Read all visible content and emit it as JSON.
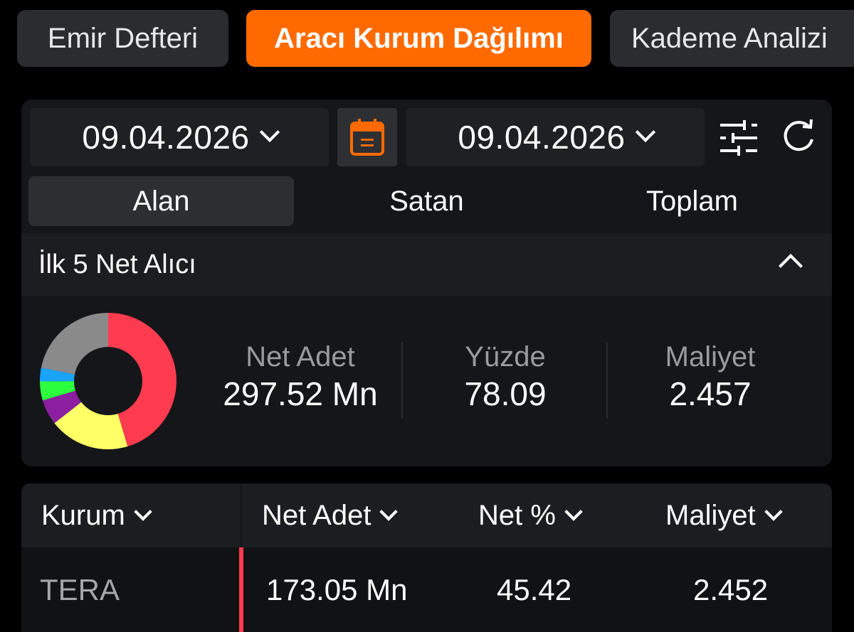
{
  "tabs": [
    {
      "label": "Emir Defteri",
      "active": false
    },
    {
      "label": "Aracı Kurum Dağılımı",
      "active": true
    },
    {
      "label": "Kademe Analizi",
      "active": false
    }
  ],
  "accent_color": "#ff6a00",
  "date_start": "09.04.2026",
  "date_end": "09.04.2026",
  "icons": {
    "calendar": "calendar-icon",
    "filter": "sliders-icon",
    "refresh": "refresh-icon"
  },
  "segments": [
    {
      "label": "Alan",
      "active": true
    },
    {
      "label": "Satan",
      "active": false
    },
    {
      "label": "Toplam",
      "active": false
    }
  ],
  "section_title": "İlk 5 Net Alıcı",
  "summary": {
    "net_adet_label": "Net Adet",
    "net_adet_value": "297.52 Mn",
    "yuzde_label": "Yüzde",
    "yuzde_value": "78.09",
    "maliyet_label": "Maliyet",
    "maliyet_value": "2.457"
  },
  "chart_data": {
    "type": "pie",
    "style": "donut",
    "slices": [
      {
        "value": 45.42,
        "color": "#ff3b4f"
      },
      {
        "value": 19.0,
        "color": "#ffff66"
      },
      {
        "value": 6.0,
        "color": "#8b1fa0"
      },
      {
        "value": 4.5,
        "color": "#2cff3e"
      },
      {
        "value": 3.2,
        "color": "#1aa3ff"
      },
      {
        "value": 21.88,
        "color": "#8a8a8a"
      }
    ]
  },
  "table": {
    "headers": {
      "kurum": "Kurum",
      "net_adet": "Net Adet",
      "net_pct": "Net %",
      "maliyet": "Maliyet"
    },
    "rows": [
      {
        "kurum": "TERA",
        "net_adet": "173.05 Mn",
        "net_pct": "45.42",
        "maliyet": "2.452",
        "color": "#ff3b4f"
      }
    ]
  }
}
